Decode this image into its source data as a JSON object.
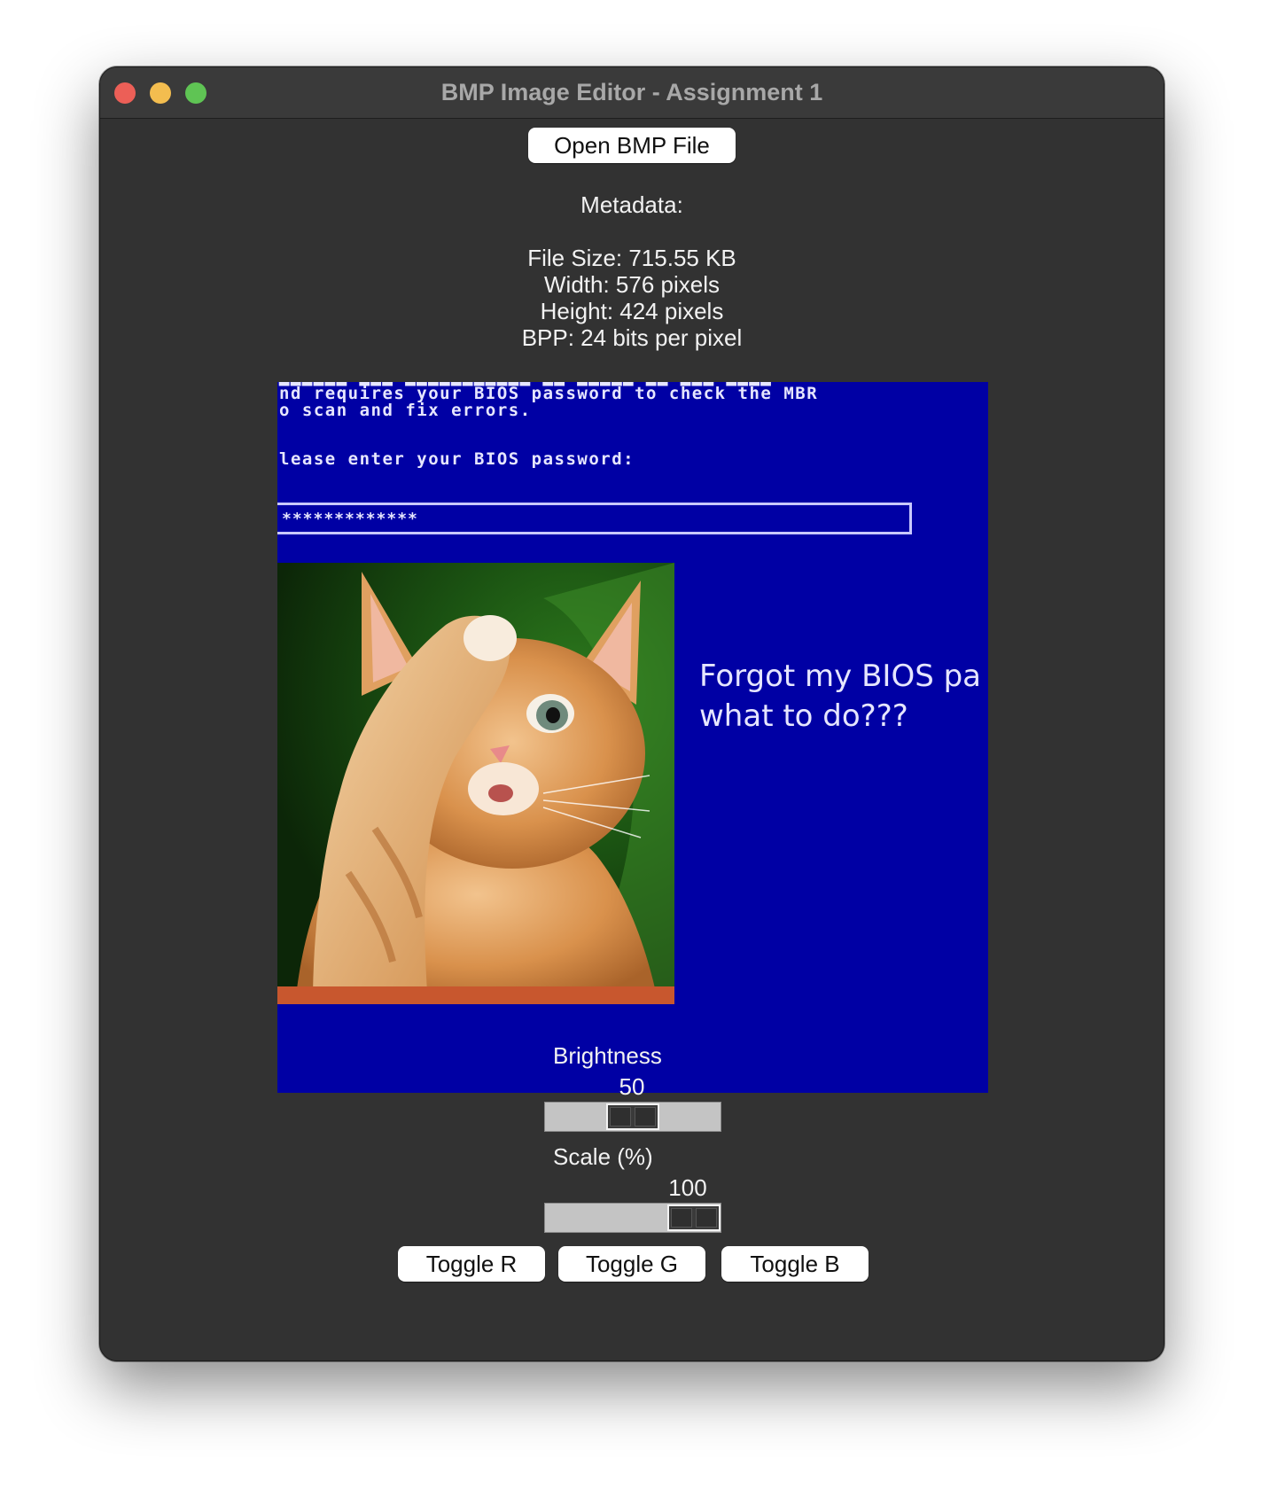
{
  "window": {
    "title": "BMP Image Editor - Assignment 1"
  },
  "toolbar": {
    "open_label": "Open BMP File"
  },
  "metadata": {
    "heading": "Metadata:",
    "file_size": "File Size: 715.55 KB",
    "width": "Width: 576 pixels",
    "height": "Height: 424 pixels",
    "bpp": "BPP: 24 bits per pixel"
  },
  "image": {
    "bios_line_1": "nd requires your BIOS password to check the MBR",
    "bios_line_2": "o scan and fix errors.",
    "bios_line_3": "lease enter your BIOS password:",
    "password_mask": "*************",
    "caption_line_1": "Forgot my BIOS pa",
    "caption_line_2": "what to do???",
    "background_color": "#0000a4"
  },
  "controls": {
    "brightness": {
      "label": "Brightness",
      "value": "50",
      "level": 0.5
    },
    "scale": {
      "label": "Scale (%)",
      "value": "100",
      "level": 1.0
    }
  },
  "channels": {
    "toggle_r": "Toggle R",
    "toggle_g": "Toggle G",
    "toggle_b": "Toggle B"
  },
  "colors": {
    "window_bg": "#323232",
    "titlebar_bg": "#3a3a3a",
    "close": "#ec5f57",
    "minimize": "#f3bd4f",
    "zoom": "#5fc454"
  }
}
